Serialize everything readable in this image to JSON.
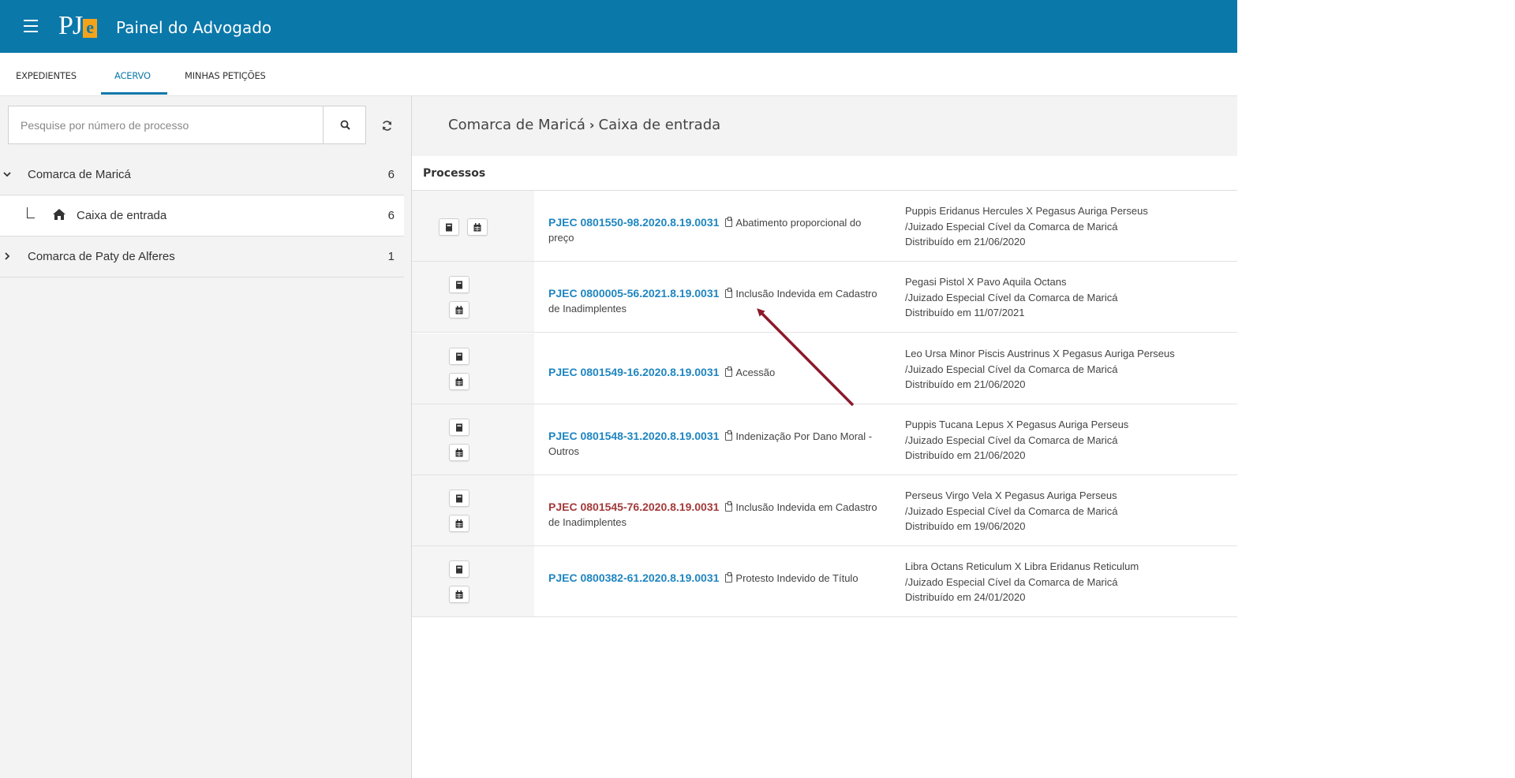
{
  "header": {
    "logo_pj": "PJ",
    "logo_e": "e",
    "title": "Painel do Advogado"
  },
  "tabs": [
    {
      "label": "EXPEDIENTES"
    },
    {
      "label": "ACERVO",
      "active": true
    },
    {
      "label": "MINHAS PETIÇÕES"
    }
  ],
  "sidebar": {
    "search_placeholder": "Pesquise por número de processo",
    "groups": [
      {
        "label": "Comarca de Maricá",
        "count": "6",
        "expanded": true
      },
      {
        "label": "Caixa de entrada",
        "count": "6",
        "child": true
      },
      {
        "label": "Comarca de Paty de Alferes",
        "count": "1",
        "expanded": false
      }
    ]
  },
  "main": {
    "breadcrumb": {
      "part1": "Comarca de Maricá",
      "separator": "›",
      "part2": "Caixa de entrada"
    },
    "section_label": "Processos",
    "processes": [
      {
        "number": "PJEC 0801550-98.2020.8.19.0031",
        "subject": "Abatimento proporcional do preço",
        "parties": "Puppis Eridanus Hercules X Pegasus Auriga Perseus",
        "court": "/Juizado Especial Cível da Comarca de Maricá",
        "distributed": "Distribuído em 21/06/2020"
      },
      {
        "number": "PJEC 0800005-56.2021.8.19.0031",
        "subject": "Inclusão Indevida em Cadastro de Inadimplentes",
        "parties": "Pegasi Pistol X Pavo Aquila Octans",
        "court": "/Juizado Especial Cível da Comarca de Maricá",
        "distributed": "Distribuído em 11/07/2021"
      },
      {
        "number": "PJEC 0801549-16.2020.8.19.0031",
        "subject": "Acessão",
        "parties": "Leo Ursa Minor Piscis Austrinus X Pegasus Auriga Perseus",
        "court": "/Juizado Especial Cível da Comarca de Maricá",
        "distributed": "Distribuído em 21/06/2020"
      },
      {
        "number": "PJEC 0801548-31.2020.8.19.0031",
        "subject": "Indenização Por Dano Moral - Outros",
        "parties": "Puppis Tucana Lepus X Pegasus Auriga Perseus",
        "court": "/Juizado Especial Cível da Comarca de Maricá",
        "distributed": "Distribuído em 21/06/2020"
      },
      {
        "number": "PJEC 0801545-76.2020.8.19.0031",
        "subject": "Inclusão Indevida em Cadastro de Inadimplentes",
        "parties": "Perseus Virgo Vela X Pegasus Auriga Perseus",
        "court": "/Juizado Especial Cível da Comarca de Maricá",
        "distributed": "Distribuído em 19/06/2020"
      },
      {
        "number": "PJEC 0800382-61.2020.8.19.0031",
        "subject": "Protesto Indevido de Título",
        "parties": "Libra Octans Reticulum X Libra Eridanus Reticulum",
        "court": "/Juizado Especial Cível da Comarca de Maricá",
        "distributed": "Distribuído em 24/01/2020"
      }
    ]
  },
  "colors": {
    "header_bg": "#0b78aa",
    "link_blue": "#1f86c0",
    "link_red": "#a33a3a",
    "arrow": "#8b1a2a"
  },
  "icons": [
    "menu-icon",
    "search-icon",
    "refresh-icon",
    "chevron-down-icon",
    "chevron-right-icon",
    "home-icon",
    "book-icon",
    "calendar-icon",
    "clipboard-icon"
  ]
}
